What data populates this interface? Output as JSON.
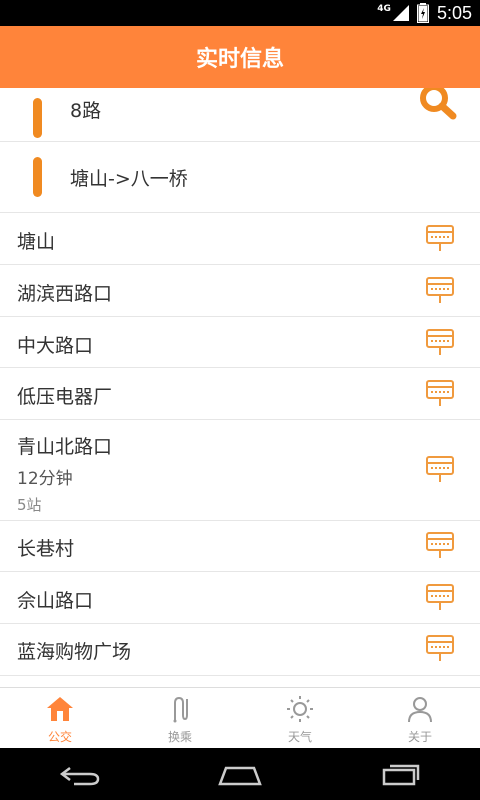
{
  "status_bar": {
    "network": "4G",
    "time": "5:05"
  },
  "header": {
    "title": "实时信息"
  },
  "route": {
    "number": "8路",
    "direction": "塘山->八一桥"
  },
  "stops": [
    {
      "name": "塘山"
    },
    {
      "name": "湖滨西路口"
    },
    {
      "name": "中大路口"
    },
    {
      "name": "低压电器厂"
    },
    {
      "name": "青山北路口",
      "eta": "12分钟",
      "stations": "5站"
    },
    {
      "name": "长巷村"
    },
    {
      "name": "佘山路口"
    },
    {
      "name": "蓝海购物广场"
    }
  ],
  "tabs": [
    {
      "label": "公交",
      "icon": "home-icon",
      "active": true
    },
    {
      "label": "换乘",
      "icon": "transfer-icon",
      "active": false
    },
    {
      "label": "天气",
      "icon": "sun-icon",
      "active": false
    },
    {
      "label": "关于",
      "icon": "person-icon",
      "active": false
    }
  ],
  "colors": {
    "accent": "#ff843a",
    "bar": "#f08a21",
    "inactive": "#999999"
  }
}
